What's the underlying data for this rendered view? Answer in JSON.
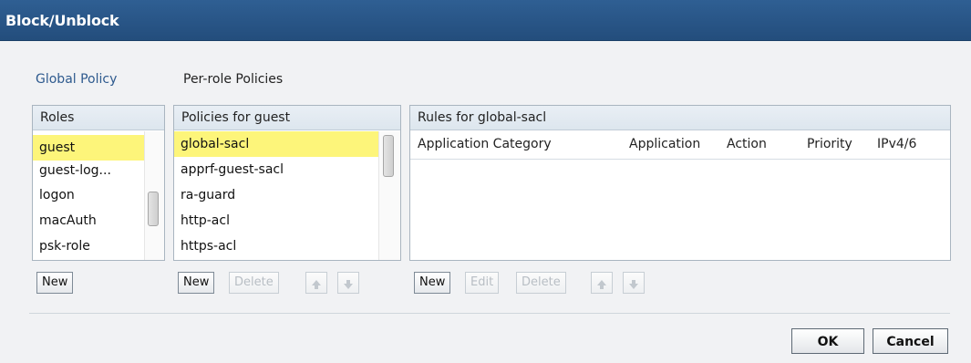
{
  "window": {
    "title": "Block/Unblock"
  },
  "tabs": [
    {
      "label": "Global Policy",
      "active": true
    },
    {
      "label": "Per-role Policies",
      "active": false
    }
  ],
  "roles_panel": {
    "header": "Roles",
    "items": [
      "guest",
      "guest-log...",
      "logon",
      "macAuth",
      "psk-role"
    ],
    "selected": "guest",
    "new_label": "New"
  },
  "policies_panel": {
    "header": "Policies for guest",
    "items": [
      "global-sacl",
      "apprf-guest-sacl",
      "ra-guard",
      "http-acl",
      "https-acl"
    ],
    "selected": "global-sacl",
    "new_label": "New",
    "delete_label": "Delete"
  },
  "rules_panel": {
    "header": "Rules for global-sacl",
    "columns": [
      "Application Category",
      "Application",
      "Action",
      "Priority",
      "IPv4/6"
    ],
    "rows": [],
    "new_label": "New",
    "edit_label": "Edit",
    "delete_label": "Delete"
  },
  "footer": {
    "ok_label": "OK",
    "cancel_label": "Cancel"
  },
  "colors": {
    "title_bar": "#2b5a8c",
    "selected_row": "#fdf57a",
    "active_tab": "#2e5a8e"
  }
}
